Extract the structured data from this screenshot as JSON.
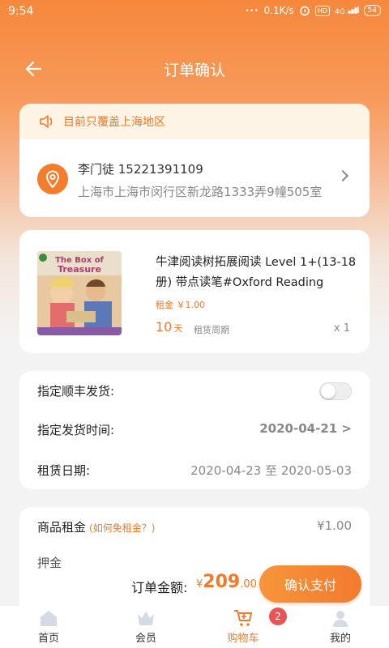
{
  "statusbar": {
    "time": "9:54",
    "speed": "0.1K/s",
    "hd": "HD",
    "network": "4G",
    "battery": "54"
  },
  "navbar": {
    "title": "订单确认"
  },
  "notice": {
    "text": "目前只覆盖上海地区"
  },
  "address": {
    "name_phone": "李门徒 15221391109",
    "line": "上海市上海市闵行区新龙路1333弄9幢505室"
  },
  "product": {
    "cover_title": "The Box of Treasure",
    "name": "牛津阅读树拓展阅读 Level 1+(13-18册) 带点读笔#Oxford Reading",
    "price": "租金 ￥1.00",
    "days_value": "10",
    "days_unit": "天",
    "period_label": "租赁周期",
    "qty": "x 1"
  },
  "options": {
    "sf_label": "指定顺丰发货:",
    "ship_time_label": "指定发货时间:",
    "ship_time_value": "2020-04-21 >",
    "rent_date_label": "租赁日期:",
    "rent_date_value": "2020-04-23 至 2020-05-03"
  },
  "summary": {
    "rent_label": "商品租金",
    "rent_link": "(如何免租金？)",
    "rent_value": "¥1.00",
    "partial_label": "押金"
  },
  "bottom": {
    "total_label": "订单金额:",
    "total_currency": "¥",
    "total_int": "209",
    "total_dec": ".00",
    "pay_label": "确认支付"
  },
  "tabs": [
    {
      "label": "首页",
      "icon": "home-icon"
    },
    {
      "label": "会员",
      "icon": "crown-icon"
    },
    {
      "label": "购物车",
      "icon": "cart-icon"
    },
    {
      "label": "我的",
      "icon": "user-icon"
    }
  ],
  "cart_badge": "2",
  "colors": {
    "accent": "#f07a2c",
    "badge": "#ea5455"
  }
}
